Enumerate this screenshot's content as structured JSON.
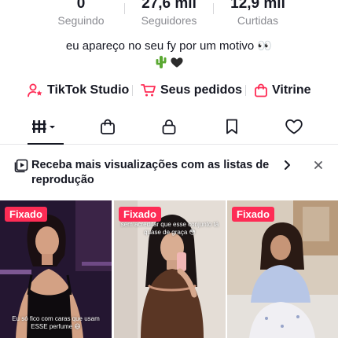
{
  "stats": [
    {
      "value": "0",
      "label": "Seguindo"
    },
    {
      "value": "27,6 mil",
      "label": "Seguidores"
    },
    {
      "value": "12,9 mil",
      "label": "Curtidas"
    }
  ],
  "bio": {
    "line1": "eu apareço no seu fy por um motivo 👀",
    "emoji1": "🌵",
    "emoji2": "🖤"
  },
  "shortcuts": [
    {
      "label": "TikTok Studio",
      "icon": "person-star-icon"
    },
    {
      "label": "Seus pedidos",
      "icon": "cart-icon"
    },
    {
      "label": "Vitrine",
      "icon": "shopping-bag-icon"
    }
  ],
  "tabs": [
    {
      "name": "videos-grid-icon",
      "active": true
    },
    {
      "name": "shop-bag-icon"
    },
    {
      "name": "lock-icon"
    },
    {
      "name": "bookmark-icon"
    },
    {
      "name": "heart-icon"
    }
  ],
  "banner": {
    "text": "Receba mais visualizações com as listas de reprodução"
  },
  "videos": [
    {
      "badge": "Fixado",
      "caption": "Eu só fico com caras que usam ESSE perfume 😄"
    },
    {
      "badge": "Fixado",
      "caption": "sem acreditar que esse conjunto tá quase de graça 😳"
    },
    {
      "badge": "Fixado",
      "caption": ""
    }
  ],
  "colors": {
    "accent": "#fe2c55",
    "text": "#161823",
    "muted": "#8a8b91"
  }
}
